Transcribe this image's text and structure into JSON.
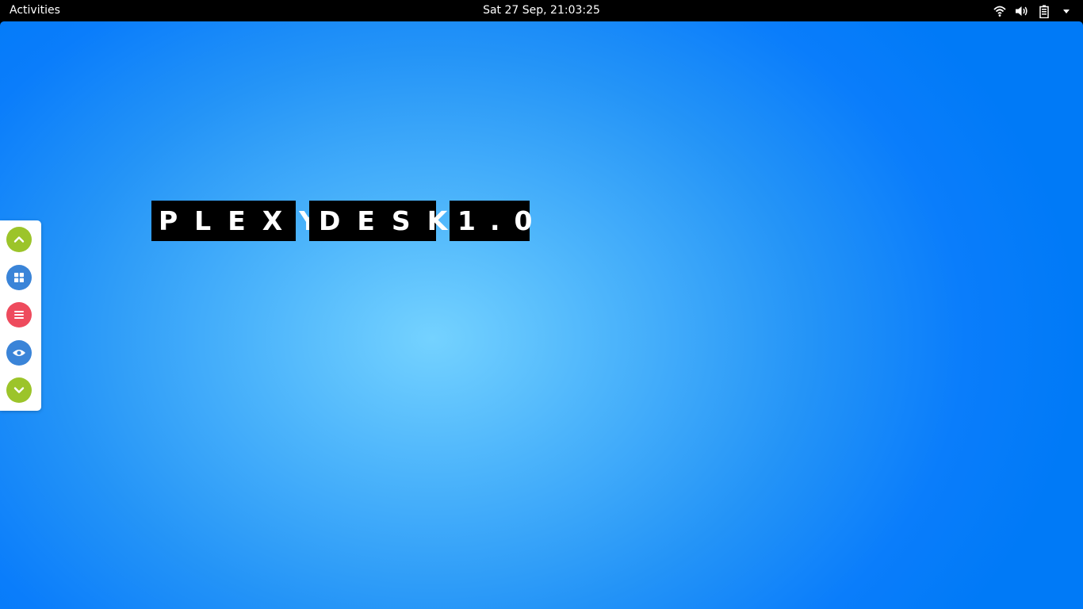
{
  "topbar": {
    "activities_label": "Activities",
    "clock_text": "Sat 27 Sep, 21:03:25",
    "tray_icons": [
      "wifi-icon",
      "volume-icon",
      "battery-icon",
      "menu-dropdown-icon"
    ]
  },
  "desktop": {
    "title_words": [
      "PLEXY",
      "DESK",
      "1.0"
    ],
    "background_colors": [
      "#74d2ff",
      "#007af7"
    ]
  },
  "dock": {
    "buttons": [
      {
        "name": "scroll-up-button",
        "icon": "chevron-up-icon",
        "color": "#9cc42a"
      },
      {
        "name": "grid-view-button",
        "icon": "grid-icon",
        "color": "#3a84d8"
      },
      {
        "name": "menu-button",
        "icon": "hamburger-menu-icon",
        "color": "#ee4b5d"
      },
      {
        "name": "view-button",
        "icon": "eye-icon",
        "color": "#3a84d8"
      },
      {
        "name": "scroll-down-button",
        "icon": "chevron-down-icon",
        "color": "#9cc42a"
      }
    ]
  }
}
